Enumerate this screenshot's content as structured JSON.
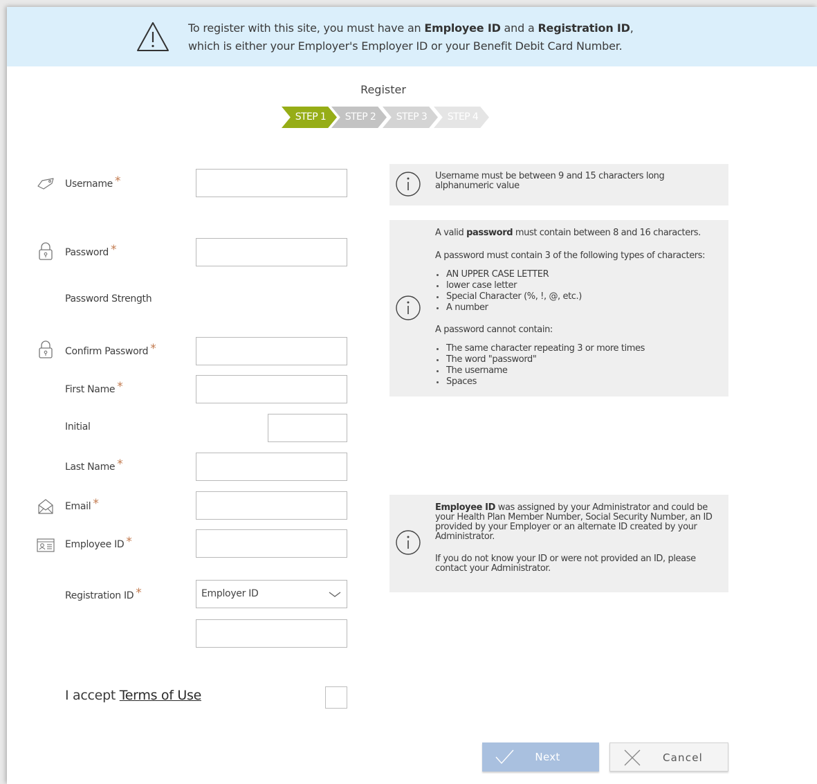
{
  "banner": {
    "part1": "To register with this site, you must have an ",
    "employee_id": "Employee ID",
    "part2": " and a ",
    "registration_id": "Registration ID",
    "part3": ",",
    "line2": "which is either your Employer's Employer ID or your Benefit Debit Card Number."
  },
  "title": "Register",
  "steps": [
    "STEP 1",
    "STEP 2",
    "STEP 3",
    "STEP 4"
  ],
  "form": {
    "username": "Username",
    "password": "Password",
    "password_strength": "Password Strength",
    "confirm_password": "Confirm Password",
    "first_name": "First Name",
    "initial": "Initial",
    "last_name": "Last Name",
    "email": "Email",
    "employee_id": "Employee ID",
    "registration_id": "Registration ID",
    "registration_select": "Employer ID",
    "required_mark": "*"
  },
  "info": {
    "username": {
      "line1": "Username must be between 9 and 15 characters long",
      "line2": "alphanumeric value"
    },
    "password": {
      "p1_a": "A valid ",
      "p1_b": "password",
      "p1_c": " must contain between 8 and 16 characters.",
      "p2": "A password must contain 3 of the following types of characters:",
      "types": [
        "AN UPPER CASE LETTER",
        "lower case letter",
        "Special Character (%, !, @, etc.)",
        "A number"
      ],
      "p3": "A password cannot contain:",
      "forbidden": [
        "The same character repeating 3 or more times",
        "The word \"password\"",
        "The username",
        "Spaces"
      ]
    },
    "employee": {
      "bold": "Employee ID",
      "text1": " was assigned by your Administrator and could be your Health Plan Member Number, Social Security Number, an ID provided by your Employer or an alternate ID created by your Administrator.",
      "text2": "If you do not know your ID or were not provided an ID, please contact your Administrator."
    }
  },
  "accept": {
    "prefix": "I accept ",
    "link": "Terms of Use"
  },
  "buttons": {
    "next": "Next",
    "cancel": "Cancel"
  }
}
